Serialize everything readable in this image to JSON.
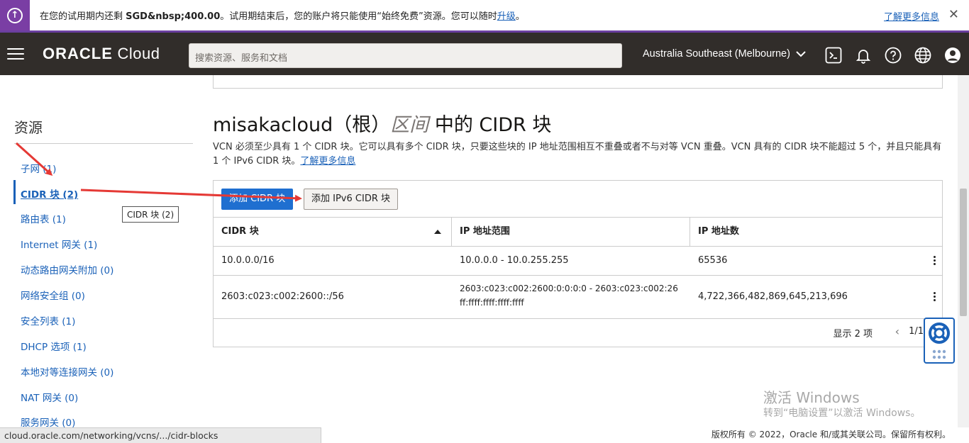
{
  "banner": {
    "text_prefix": "在您的试用期内还剩 ",
    "amount": "SGD&nbsp;400.00",
    "text_suffix": "。试用期结束后，您的账户将只能使用“始终免费”资源。您可以随时",
    "upgrade_link": "升级",
    "period": "。",
    "learn_more": "了解更多信息",
    "close": "✕",
    "icon": "arrow-up-circle-icon"
  },
  "header": {
    "logo_bold": "ORACLE",
    "logo_light": " Cloud",
    "search_placeholder": "搜索资源、服务和文档",
    "region": "Australia Southeast (Melbourne)",
    "icons": [
      "cloud-shell-icon",
      "bell-icon",
      "help-icon",
      "globe-icon",
      "user-icon"
    ]
  },
  "sidebar": {
    "title": "资源",
    "items": [
      {
        "label": "子网 (1)"
      },
      {
        "label": "CIDR 块 (2)"
      },
      {
        "label": "路由表 (1)"
      },
      {
        "label": "Internet 网关 (1)"
      },
      {
        "label": "动态路由网关附加 (0)"
      },
      {
        "label": "网络安全组 (0)"
      },
      {
        "label": "安全列表 (1)"
      },
      {
        "label": "DHCP 选项 (1)"
      },
      {
        "label": "本地对等连接网关 (0)"
      },
      {
        "label": "NAT 网关 (0)"
      },
      {
        "label": "服务网关 (0)"
      }
    ],
    "tooltip": "CIDR 块 (2)"
  },
  "main": {
    "heading_prefix": "misakacloud（根）",
    "heading_italic": "区间",
    "heading_suffix": " 中的 CIDR 块",
    "description": "VCN 必须至少具有 1 个 CIDR 块。它可以具有多个 CIDR 块，只要这些块的 IP 地址范围相互不重叠或者不与对等 VCN 重叠。VCN 具有的 CIDR 块不能超过 5 个，并且只能具有 1 个 IPv6 CIDR 块。",
    "learn_more": "了解更多信息",
    "add_cidr_button": "添加 CIDR 块",
    "add_ipv6_button": "添加 IPv6 CIDR 块",
    "columns": [
      "CIDR 块",
      "IP 地址范围",
      "IP 地址数"
    ],
    "rows": [
      {
        "cidr": "10.0.0.0/16",
        "range1": "10.0.0.0 - 10.0.255.255",
        "range2": "",
        "count": "65536"
      },
      {
        "cidr": "2603:c023:c002:2600::/56",
        "range1": "2603:c023:c002:2600:0:0:0:0 - 2603:c023:c002:26",
        "range2": "ff:ffff:ffff:ffff:ffff",
        "count": "4,722,366,482,869,645,213,696"
      }
    ],
    "showing": "显示 2 项",
    "pager_prev": "‹",
    "page": "1/1"
  },
  "watermark": {
    "line1": "激活 Windows",
    "line2": "转到“电脑设置”以激活 Windows。"
  },
  "status_url": "cloud.oracle.com/networking/vcns/.../cidr-blocks",
  "copyright": "版权所有 © 2022，Oracle 和/或其关联公司。保留所有权利。",
  "colors": {
    "header_bg": "#312d2a",
    "banner_accent": "#7a3ea4",
    "link": "#1a61b8",
    "primary_button": "#1f6fd0",
    "annotation_arrow": "#e53935"
  }
}
